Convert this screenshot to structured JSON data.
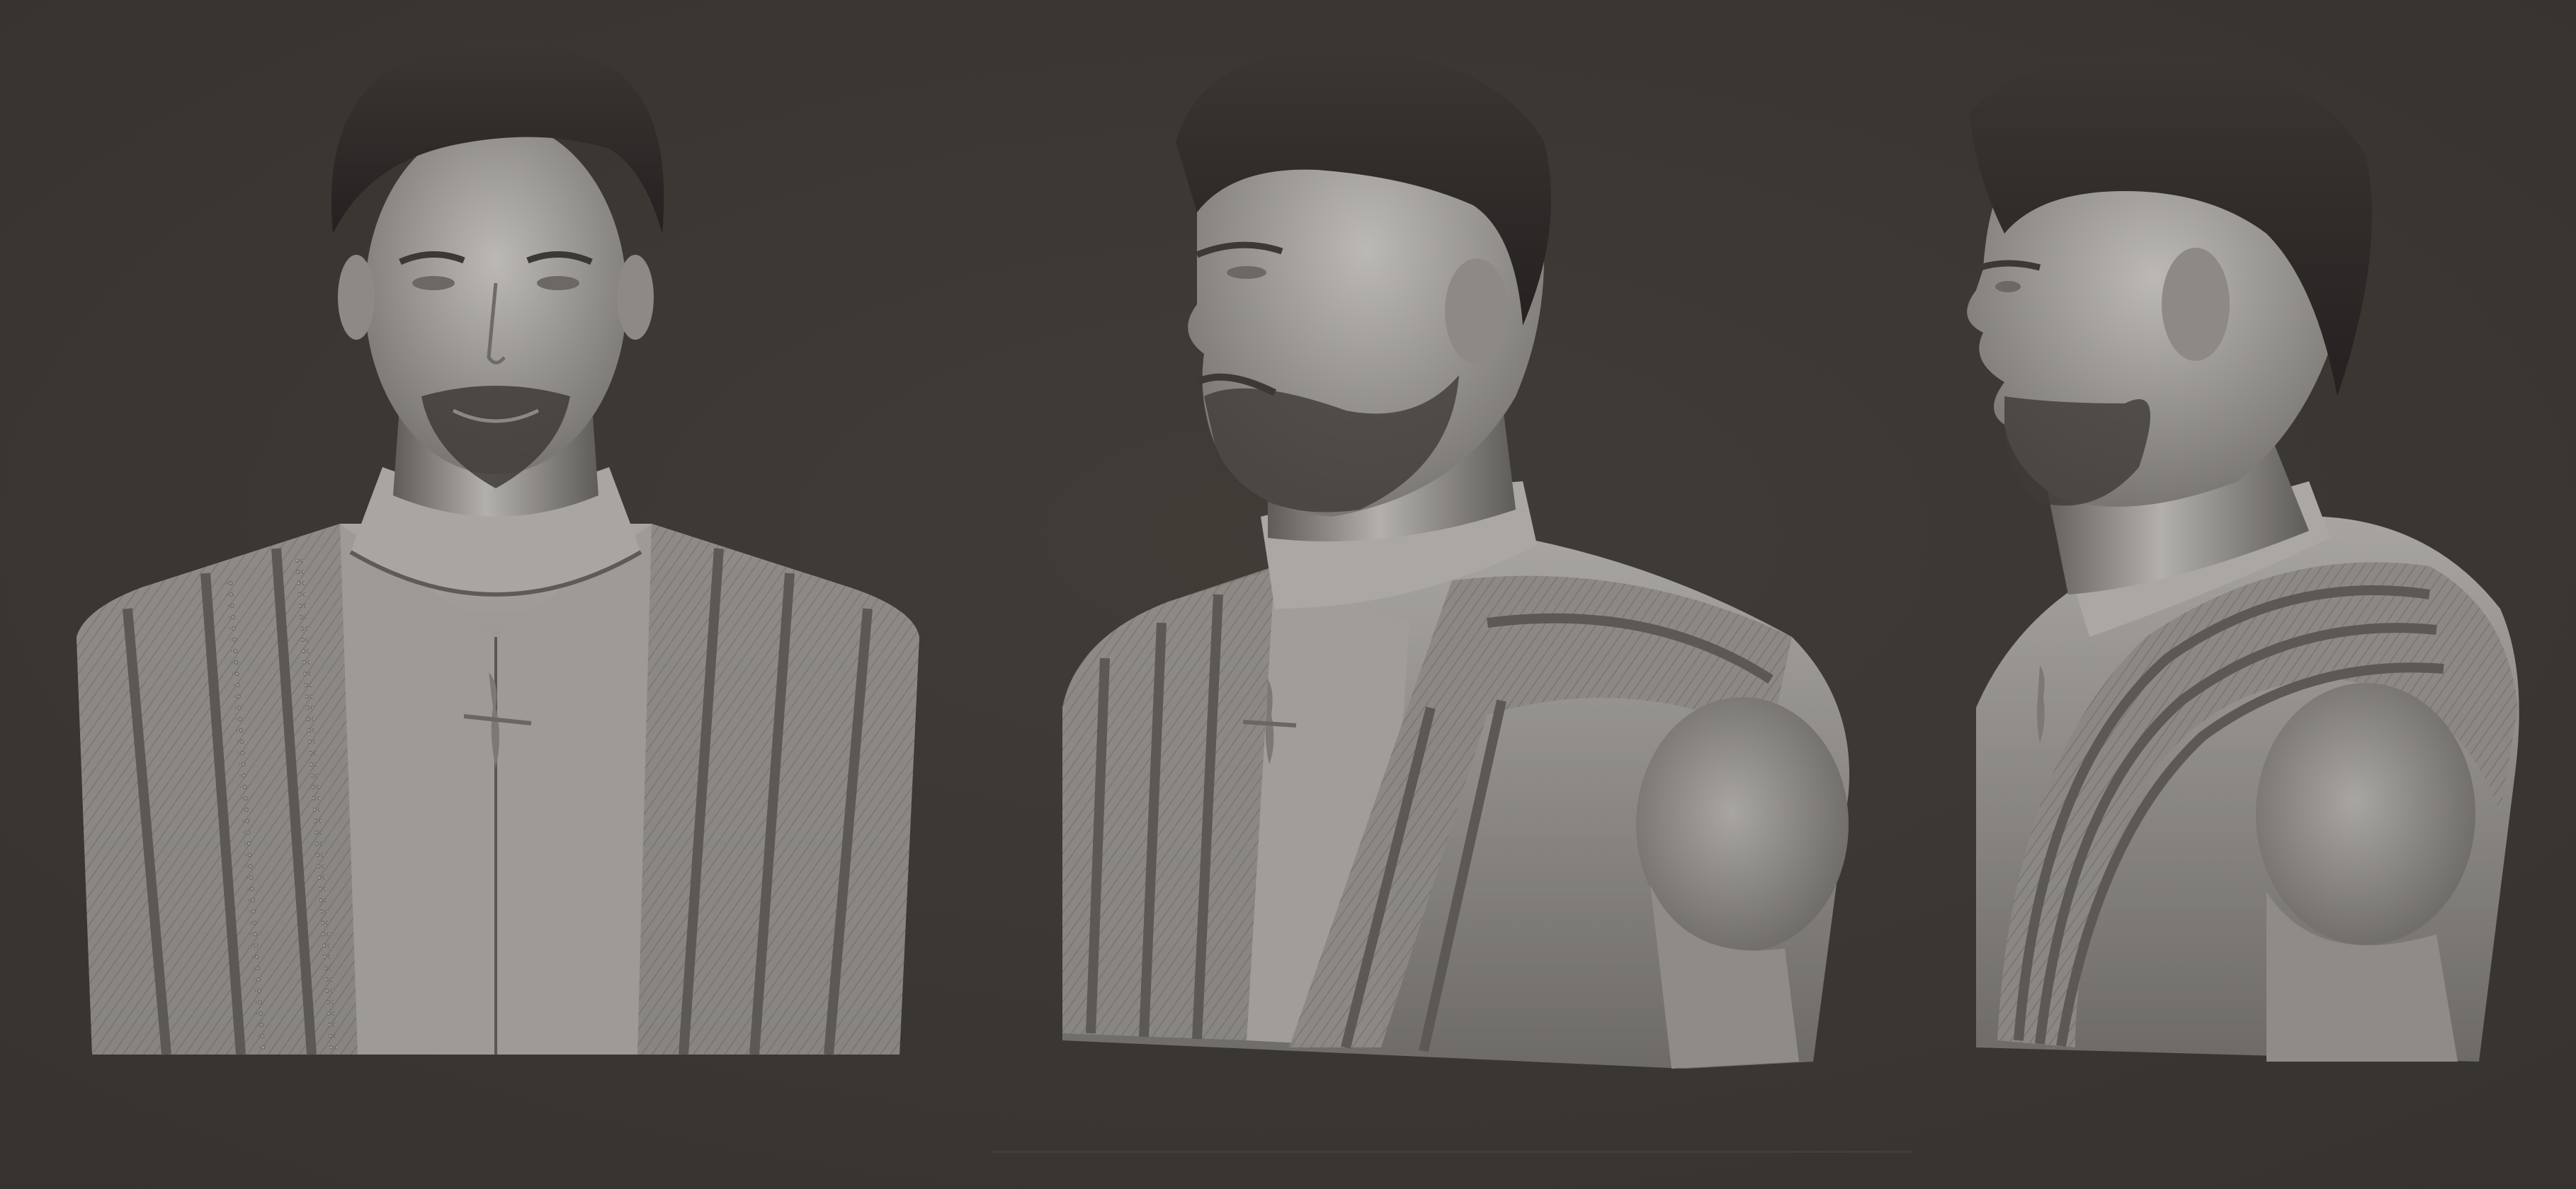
{
  "colors": {
    "background": "#3c3833",
    "clay_light": "#b9b6b1",
    "clay_mid": "#8a8782",
    "clay_dark": "#4b4844",
    "hair": "#2b2826",
    "baseline": "#4a4641"
  },
  "views": [
    {
      "id": "front",
      "angle": "front"
    },
    {
      "id": "three-quarter",
      "angle": "three-quarter"
    },
    {
      "id": "profile",
      "angle": "left-profile"
    }
  ]
}
